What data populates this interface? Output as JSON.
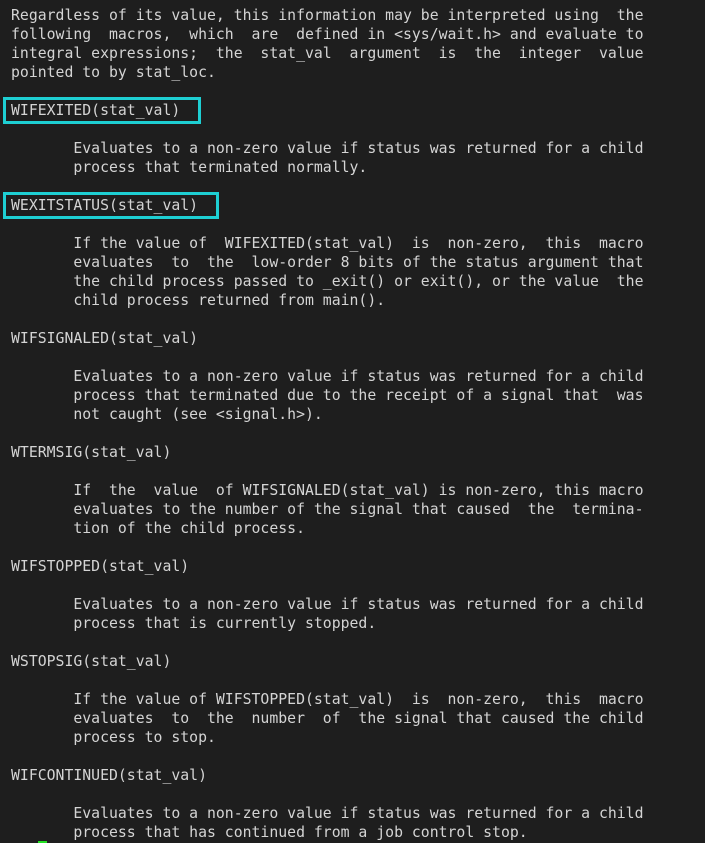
{
  "colors": {
    "background": "#1e1e1e",
    "text": "#d4d4d4",
    "highlight_box": "#1ecfd3",
    "cursor": "#22e022"
  },
  "lines": [
    {
      "text": "Regardless of its value, this information may be interpreted using  the"
    },
    {
      "text": "following  macros,  which  are  defined in <sys/wait.h> and evaluate to"
    },
    {
      "text": "integral expressions;  the  stat_val  argument  is  the  integer  value"
    },
    {
      "text": "pointed to by stat_loc."
    },
    {
      "text": ""
    },
    {
      "text": "WIFEXITED(stat_val)",
      "highlighted": true
    },
    {
      "text": ""
    },
    {
      "text": "       Evaluates to a non-zero value if status was returned for a child"
    },
    {
      "text": "       process that terminated normally."
    },
    {
      "text": ""
    },
    {
      "text": "WEXITSTATUS(stat_val)",
      "highlighted": true
    },
    {
      "text": ""
    },
    {
      "text": "       If the value of  WIFEXITED(stat_val)  is  non-zero,  this  macro"
    },
    {
      "text": "       evaluates  to  the  low-order 8 bits of the status argument that"
    },
    {
      "text": "       the child process passed to _exit() or exit(), or the value  the"
    },
    {
      "text": "       child process returned from main()."
    },
    {
      "text": ""
    },
    {
      "text": "WIFSIGNALED(stat_val)"
    },
    {
      "text": ""
    },
    {
      "text": "       Evaluates to a non-zero value if status was returned for a child"
    },
    {
      "text": "       process that terminated due to the receipt of a signal that  was"
    },
    {
      "text": "       not caught (see <signal.h>)."
    },
    {
      "text": ""
    },
    {
      "text": "WTERMSIG(stat_val)"
    },
    {
      "text": ""
    },
    {
      "text": "       If  the  value  of WIFSIGNALED(stat_val) is non-zero, this macro"
    },
    {
      "text": "       evaluates to the number of the signal that caused  the  termina-"
    },
    {
      "text": "       tion of the child process."
    },
    {
      "text": ""
    },
    {
      "text": "WIFSTOPPED(stat_val)"
    },
    {
      "text": ""
    },
    {
      "text": "       Evaluates to a non-zero value if status was returned for a child"
    },
    {
      "text": "       process that is currently stopped."
    },
    {
      "text": ""
    },
    {
      "text": "WSTOPSIG(stat_val)"
    },
    {
      "text": ""
    },
    {
      "text": "       If the value of WIFSTOPPED(stat_val)  is  non-zero,  this  macro"
    },
    {
      "text": "       evaluates  to  the  number  of  the signal that caused the child"
    },
    {
      "text": "       process to stop."
    },
    {
      "text": ""
    },
    {
      "text": "WIFCONTINUED(stat_val)"
    },
    {
      "text": ""
    },
    {
      "text": "       Evaluates to a non-zero value if status was returned for a child"
    },
    {
      "text": "       process that has continued from a job control stop."
    }
  ]
}
